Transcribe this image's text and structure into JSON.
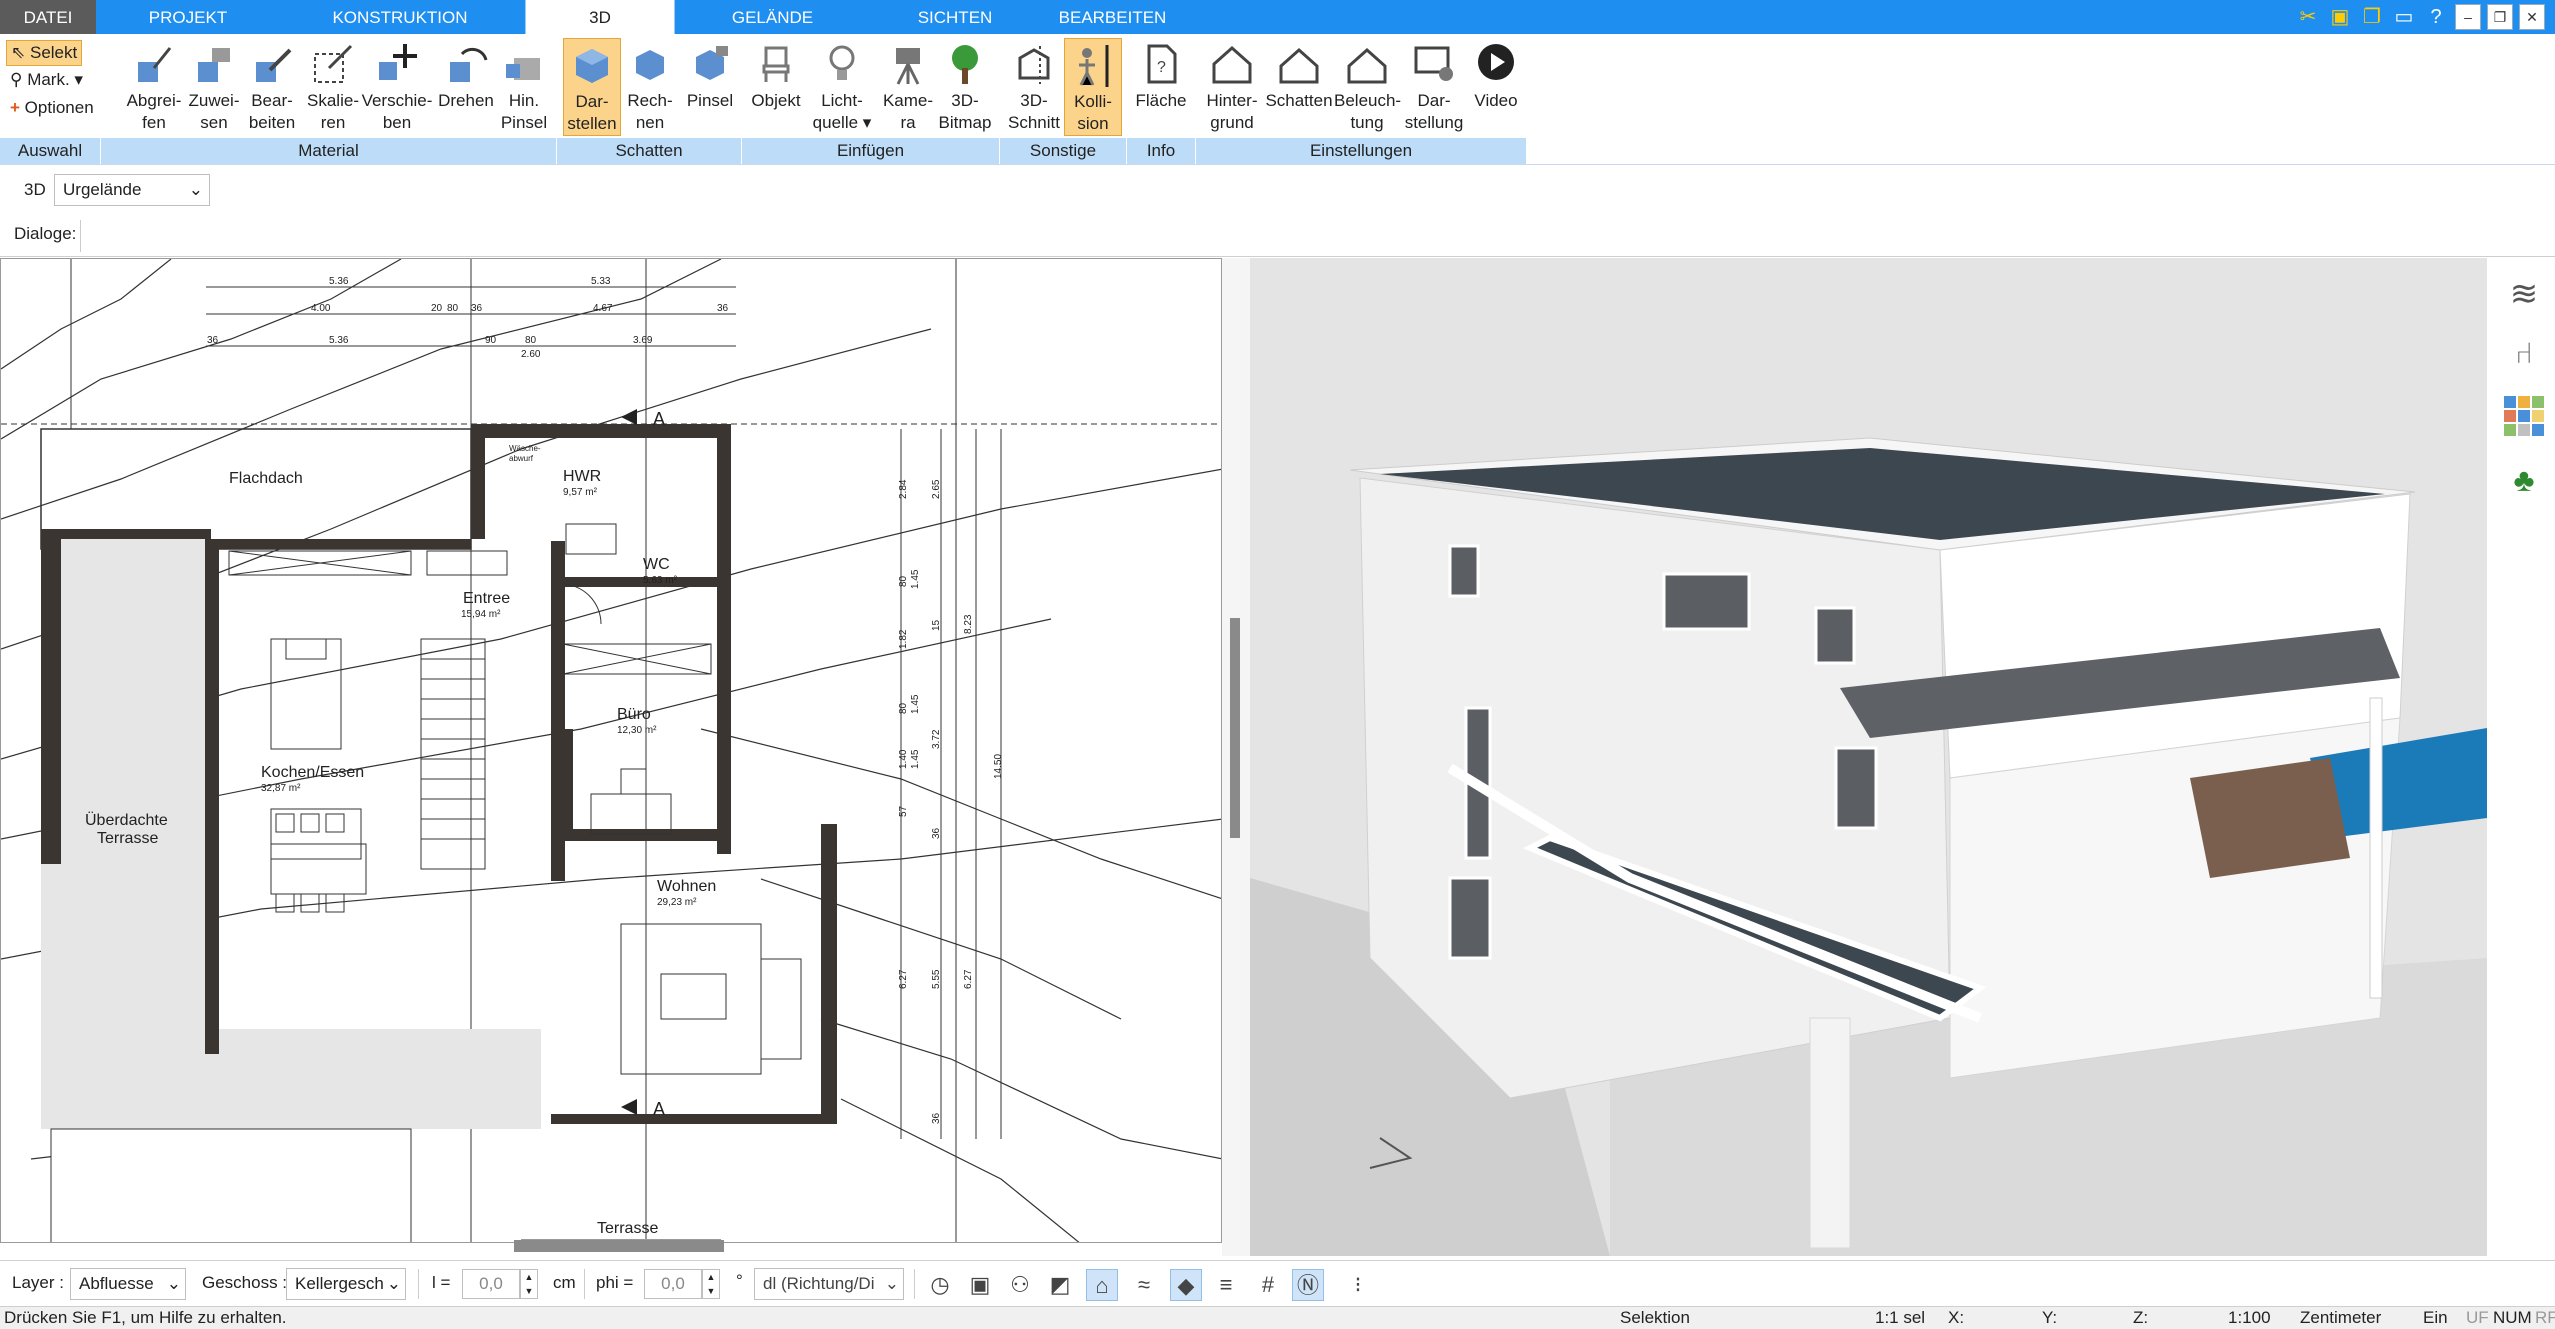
{
  "tabs": [
    {
      "label": "DATEI"
    },
    {
      "label": "PROJEKT"
    },
    {
      "label": "KONSTRUKTION"
    },
    {
      "label": "3D"
    },
    {
      "label": "GELÄNDE"
    },
    {
      "label": "SICHTEN"
    },
    {
      "label": "BEARBEITEN"
    }
  ],
  "ribbon": {
    "auswahl": {
      "selekt": "Selekt",
      "mark": "Mark.",
      "optionen": "Optionen",
      "group": "Auswahl"
    },
    "material": {
      "group": "Material",
      "items": [
        {
          "l1": "Abgrei-",
          "l2": "fen"
        },
        {
          "l1": "Zuwei-",
          "l2": "sen"
        },
        {
          "l1": "Bear-",
          "l2": "beiten"
        },
        {
          "l1": "Skalie-",
          "l2": "ren"
        },
        {
          "l1": "Verschie-",
          "l2": "ben"
        },
        {
          "l1": "Drehen",
          "l2": ""
        },
        {
          "l1": "Hin.",
          "l2": "Pinsel"
        }
      ]
    },
    "schatten": {
      "group": "Schatten",
      "items": [
        {
          "l1": "Dar-",
          "l2": "stellen"
        },
        {
          "l1": "Rech-",
          "l2": "nen"
        },
        {
          "l1": "Pinsel",
          "l2": ""
        }
      ]
    },
    "einfuegen": {
      "group": "Einfügen",
      "items": [
        {
          "l1": "Objekt",
          "l2": ""
        },
        {
          "l1": "Licht-",
          "l2": "quelle"
        },
        {
          "l1": "Kame-",
          "l2": "ra"
        },
        {
          "l1": "3D-",
          "l2": "Bitmap"
        }
      ]
    },
    "sonstige": {
      "group": "Sonstige",
      "items": [
        {
          "l1": "3D-",
          "l2": "Schnitt"
        },
        {
          "l1": "Kolli-",
          "l2": "sion"
        }
      ]
    },
    "info": {
      "group": "Info",
      "items": [
        {
          "l1": "Fläche",
          "l2": ""
        }
      ]
    },
    "einstellungen": {
      "group": "Einstellungen",
      "items": [
        {
          "l1": "Hinter-",
          "l2": "grund"
        },
        {
          "l1": "Schatten",
          "l2": ""
        },
        {
          "l1": "Beleuch-",
          "l2": "tung"
        },
        {
          "l1": "Dar-",
          "l2": "stellung"
        },
        {
          "l1": "Video",
          "l2": ""
        }
      ]
    }
  },
  "toolbar2": {
    "mode": "3D",
    "terrain": "Urgelände"
  },
  "toolbar3": {
    "dialoge": "Dialoge:"
  },
  "plan": {
    "rooms": [
      {
        "name": "Flachdach",
        "area": ""
      },
      {
        "name": "HWR",
        "area": "9,57 m²"
      },
      {
        "name": "WC",
        "area": "5,63 m²"
      },
      {
        "name": "Entree",
        "area": "15,94 m²"
      },
      {
        "name": "Büro",
        "area": "12,30 m²"
      },
      {
        "name": "Kochen/Essen",
        "area": "32,87 m²"
      },
      {
        "name": "Wohnen",
        "area": "29,23 m²"
      },
      {
        "name": "Überdachte",
        "area": "Terrasse"
      },
      {
        "name": "Terrasse",
        "area": ""
      }
    ],
    "waesche": [
      "Wäsche-",
      "abwurf"
    ],
    "dims_top": [
      "5.36",
      "5.33",
      "4.00",
      "20",
      "80",
      "36",
      "4.67",
      "36",
      "36",
      "5.36",
      "90",
      "80",
      "3.69",
      "2.60"
    ],
    "dims_right": [
      "2.84",
      "2.65",
      "80",
      "1.45",
      "15",
      "1.82",
      "80",
      "1.45",
      "3.72",
      "1.40",
      "1.45",
      "57",
      "36",
      "6.27",
      "5.55",
      "6.27",
      "36",
      "8.23",
      "14.50"
    ],
    "section_marker": "A"
  },
  "bottombar": {
    "layer_label": "Layer :",
    "layer_value": "Abfluesse",
    "geschoss_label": "Geschoss :",
    "geschoss_value": "Kellergesch",
    "l_label": "l =",
    "l_value": "0,0",
    "l_unit": "cm",
    "phi_label": "phi =",
    "phi_value": "0,0",
    "phi_unit": "°",
    "dl_value": "dl (Richtung/Di"
  },
  "status": {
    "hint": "Drücken Sie F1, um Hilfe zu erhalten.",
    "mode": "Selektion",
    "sel": "1:1 sel",
    "x": "X:",
    "y": "Y:",
    "z": "Z:",
    "scale": "1:100",
    "unit": "Zentimeter",
    "ein": "Ein",
    "uf": "UF",
    "num": "NUM",
    "rf": "RF"
  },
  "colors": {
    "accent": "#1e8ef0",
    "group_bg": "#bcdcf8",
    "active_btn": "#fbd38b"
  }
}
